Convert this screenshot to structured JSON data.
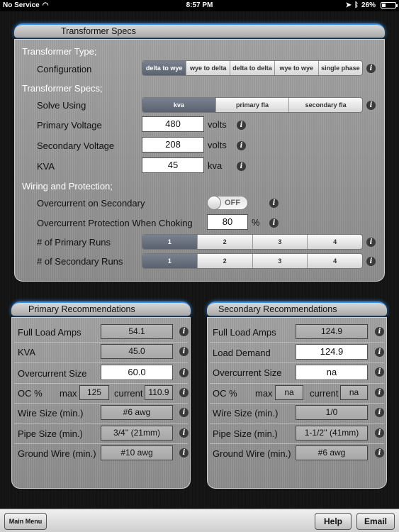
{
  "status": {
    "carrier": "No Service",
    "time": "8:57 PM",
    "battery": "26%",
    "battery_level": 0.26
  },
  "specs": {
    "header": "Transformer Specs",
    "type_title": "Transformer Type;",
    "config_label": "Configuration",
    "configs": [
      "delta to wye",
      "wye to delta",
      "delta to delta",
      "wye to wye",
      "single phase"
    ],
    "specs_title": "Transformer Specs;",
    "solve_label": "Solve Using",
    "solve_options": [
      "kva",
      "primary fla",
      "secondary fla"
    ],
    "primary_voltage_label": "Primary Voltage",
    "primary_voltage": "480",
    "secondary_voltage_label": "Secondary Voltage",
    "secondary_voltage": "208",
    "volts_unit": "volts",
    "kva_label": "KVA",
    "kva": "45",
    "kva_unit": "kva",
    "wiring_title": "Wiring and Protection;",
    "overcurrent_secondary_label": "Overcurrent on Secondary",
    "toggle_text": "OFF",
    "choking_label": "Overcurrent Protection When Choking",
    "choking_value": "80",
    "percent_unit": "%",
    "primary_runs_label": "# of Primary Runs",
    "secondary_runs_label": "# of Secondary Runs",
    "runs": [
      "1",
      "2",
      "3",
      "4"
    ]
  },
  "primary": {
    "header": "Primary Recommendations",
    "fla_label": "Full Load Amps",
    "fla": "54.1",
    "kva_label": "KVA",
    "kva": "45.0",
    "oc_size_label": "Overcurrent Size",
    "oc_size": "60.0",
    "oc_pct_label": "OC %",
    "max_label": "max",
    "max": "125",
    "current_label": "current",
    "current": "110.9",
    "wire_label": "Wire Size (min.)",
    "wire": "#6 awg",
    "pipe_label": "Pipe Size (min.)",
    "pipe": "3/4'' (21mm)",
    "ground_label": "Ground Wire (min.)",
    "ground": "#10 awg"
  },
  "secondary": {
    "header": "Secondary Recommendations",
    "fla_label": "Full Load Amps",
    "fla": "124.9",
    "demand_label": "Load Demand",
    "demand": "124.9",
    "oc_size_label": "Overcurrent Size",
    "oc_size": "na",
    "oc_pct_label": "OC %",
    "max_label": "max",
    "max": "na",
    "current_label": "current",
    "current": "na",
    "wire_label": "Wire Size (min.)",
    "wire": "1/0",
    "pipe_label": "Pipe Size (min.)",
    "pipe": "1-1/2'' (41mm)",
    "ground_label": "Ground Wire (min.)",
    "ground": "#6 awg"
  },
  "toolbar": {
    "main_menu": "Main Menu",
    "help": "Help",
    "email": "Email"
  },
  "icons": {
    "info": "i"
  }
}
